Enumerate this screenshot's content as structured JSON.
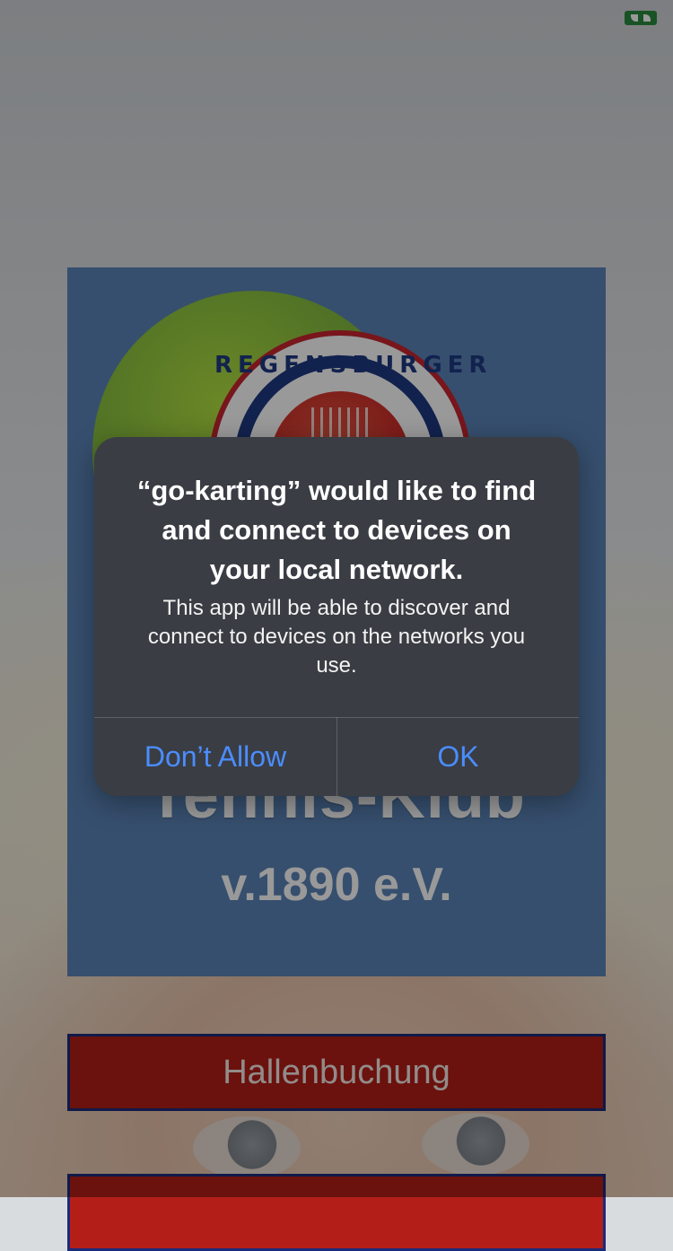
{
  "background": {
    "status_icon": "screen-share-indicator",
    "hero": {
      "club_name": "Tennis-Klub",
      "club_year": "v.1890 e.V.",
      "logo_text": "REGENSBURGER"
    },
    "buttons": [
      {
        "label": "Hallenbuchung"
      },
      {
        "label": ""
      }
    ]
  },
  "alert": {
    "title": "“go-karting” would like to find and connect to devices on your local network.",
    "message": "This app will be able to discover and connect to devices on the networks you use.",
    "actions": {
      "deny": "Don’t Allow",
      "allow": "OK"
    }
  },
  "colors": {
    "alert_bg": "#3a3d43",
    "action_blue": "#4a8dff",
    "button_red": "#b31f18",
    "button_border": "#1c2a7a",
    "hero_blue": "#5b84b7"
  }
}
